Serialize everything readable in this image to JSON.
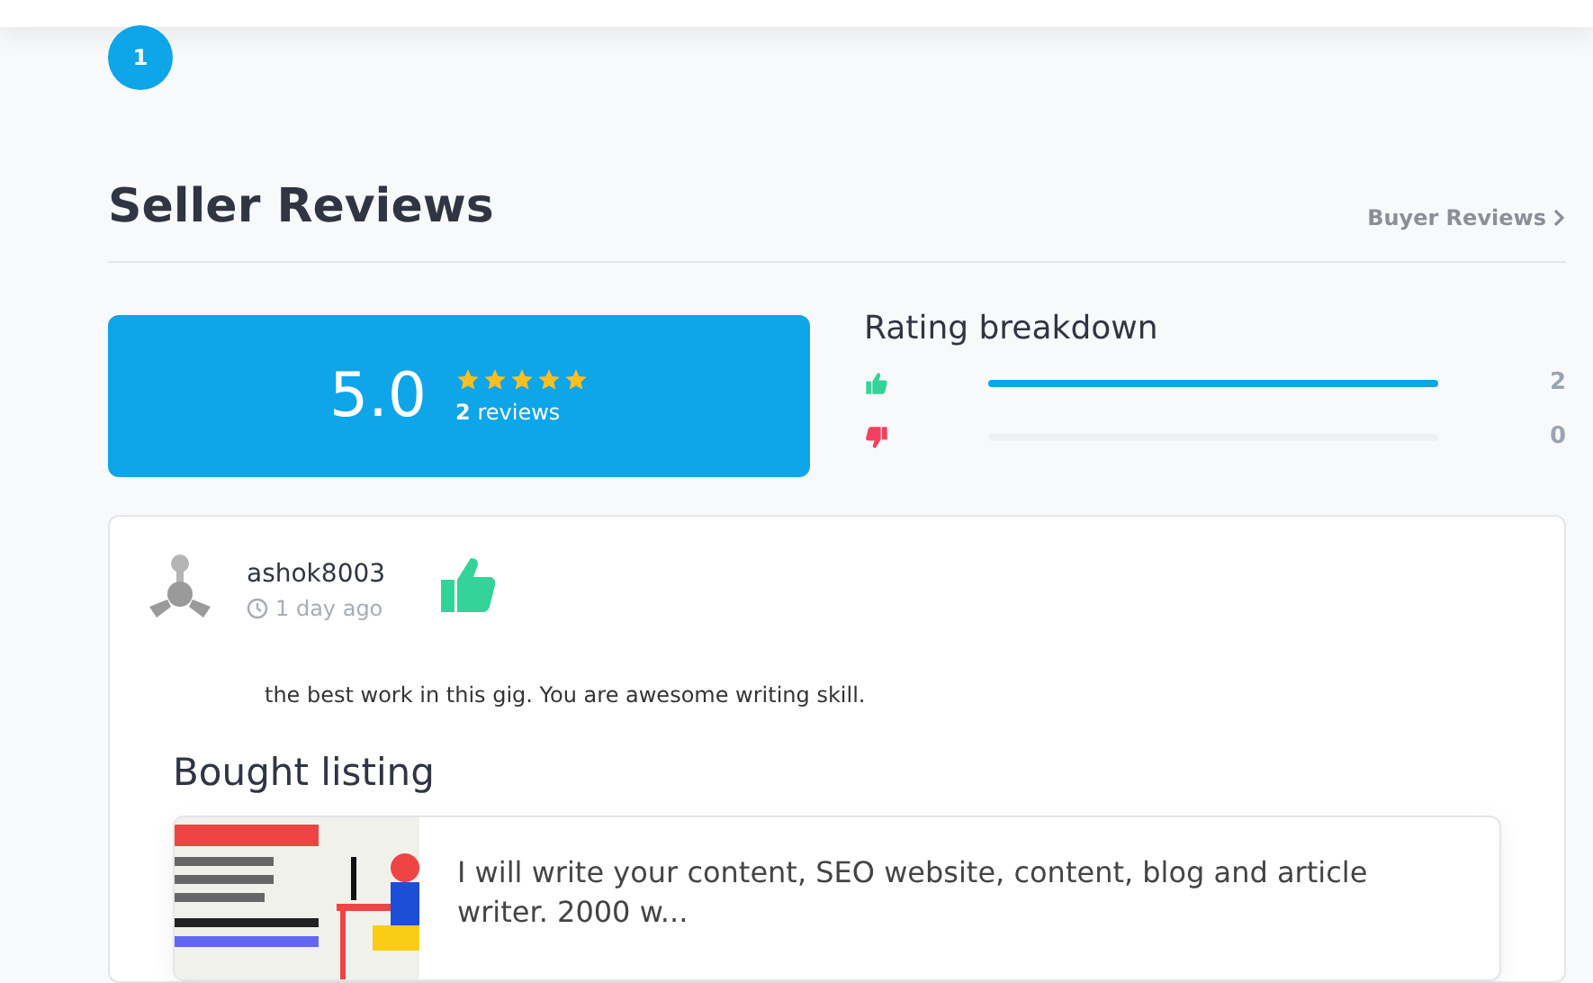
{
  "pagination": {
    "pages": [
      {
        "label": "1",
        "selected": true
      }
    ]
  },
  "section": {
    "title": "Seller Reviews",
    "link": "Buyer Reviews"
  },
  "summary": {
    "score": "5.0",
    "stars": 5,
    "count": "2",
    "count_label": "reviews"
  },
  "breakdown": {
    "title": "Rating breakdown",
    "rows": [
      {
        "kind": "up",
        "level": 1,
        "count": "2"
      },
      {
        "kind": "down",
        "level": 0,
        "count": "0"
      }
    ]
  },
  "reviews": [
    {
      "user": "ashok8003",
      "time": "1 day ago",
      "kind": "up",
      "text": "the best work in this gig. You are awesome writing skill.",
      "listing_heading": "Bought listing",
      "listing": {
        "title": "I will write your content, SEO website, content, blog and article writer. 2000 w..."
      }
    }
  ]
}
